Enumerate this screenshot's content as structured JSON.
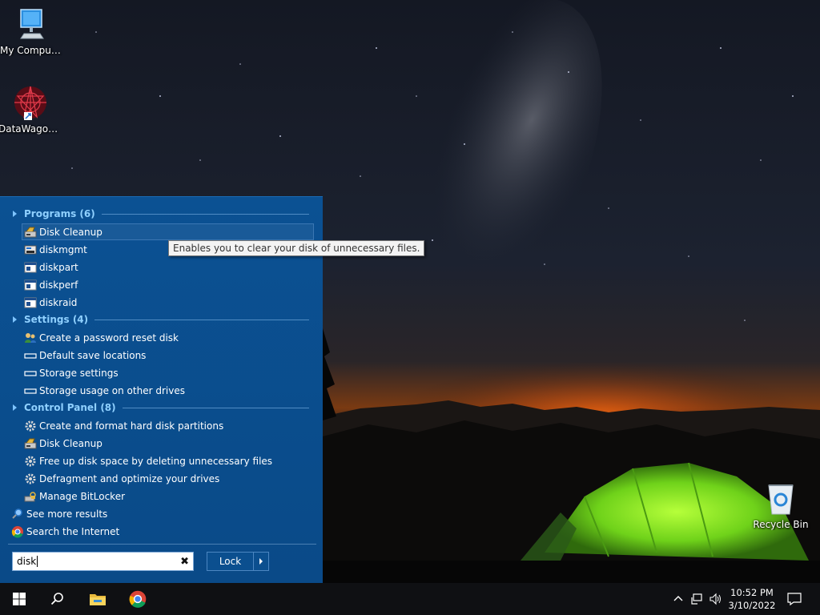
{
  "desktop": {
    "icons": [
      {
        "label": "My Computer",
        "icon": "computer-icon"
      },
      {
        "label": "DataWagon...",
        "icon": "datawagon-icon"
      },
      {
        "label": "Recycle Bin",
        "icon": "recycle-bin-icon"
      }
    ]
  },
  "start_menu": {
    "groups": [
      {
        "header": "Programs (6)",
        "items": [
          {
            "label": "Disk Cleanup",
            "icon": "disk-cleanup-icon"
          },
          {
            "label": "diskmgmt",
            "icon": "diskmgmt-icon"
          },
          {
            "label": "diskpart",
            "icon": "console-icon"
          },
          {
            "label": "diskperf",
            "icon": "console-icon"
          },
          {
            "label": "diskraid",
            "icon": "console-icon"
          }
        ]
      },
      {
        "header": "Settings (4)",
        "items": [
          {
            "label": "Create a password reset disk",
            "icon": "users-icon"
          },
          {
            "label": "Default save locations",
            "icon": "settings-item-icon"
          },
          {
            "label": "Storage settings",
            "icon": "settings-item-icon"
          },
          {
            "label": "Storage usage on other drives",
            "icon": "settings-item-icon"
          }
        ]
      },
      {
        "header": "Control Panel (8)",
        "items": [
          {
            "label": "Create and format hard disk partitions",
            "icon": "admin-tools-icon"
          },
          {
            "label": "Disk Cleanup",
            "icon": "disk-cleanup-icon"
          },
          {
            "label": "Free up disk space by deleting unnecessary files",
            "icon": "admin-tools-icon"
          },
          {
            "label": "Defragment and optimize your drives",
            "icon": "admin-tools-icon"
          },
          {
            "label": "Manage BitLocker",
            "icon": "bitlocker-icon"
          }
        ]
      }
    ],
    "see_more": "See more results",
    "search_internet": "Search the Internet",
    "search": {
      "value": "disk"
    },
    "lock_button": "Lock",
    "tooltip": "Enables you to clear your disk of unnecessary files."
  },
  "taskbar": {
    "items": [
      "start-icon",
      "search-icon",
      "file-explorer-icon",
      "chrome-icon"
    ],
    "time": "10:52 PM",
    "date": "3/10/2022"
  }
}
